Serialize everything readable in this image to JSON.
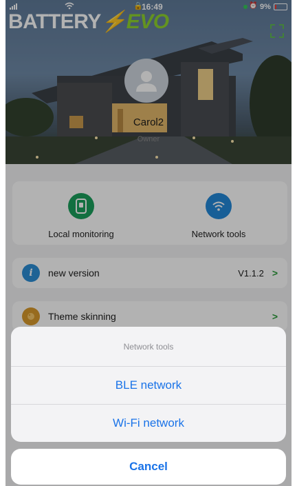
{
  "status_bar": {
    "time": "16:49",
    "battery_percent": "9%"
  },
  "brand": {
    "part1": "BATTERY",
    "part2": "EVO"
  },
  "profile": {
    "name": "Carol2",
    "role": "Owner"
  },
  "tools": [
    {
      "label": "Local monitoring",
      "icon": "device-monitor-icon",
      "color": "#1aa05c"
    },
    {
      "label": "Network tools",
      "icon": "wifi-icon",
      "color": "#2388d8"
    }
  ],
  "settings": [
    {
      "label": "new version",
      "value": "V1.1.2",
      "icon": "info-icon",
      "color": "#2c8fd6"
    },
    {
      "label": "Theme skinning",
      "value": "",
      "icon": "palette-icon",
      "color": "#d99a2b"
    }
  ],
  "action_sheet": {
    "title": "Network tools",
    "actions": [
      "BLE network",
      "Wi-Fi network"
    ],
    "cancel_label": "Cancel"
  }
}
